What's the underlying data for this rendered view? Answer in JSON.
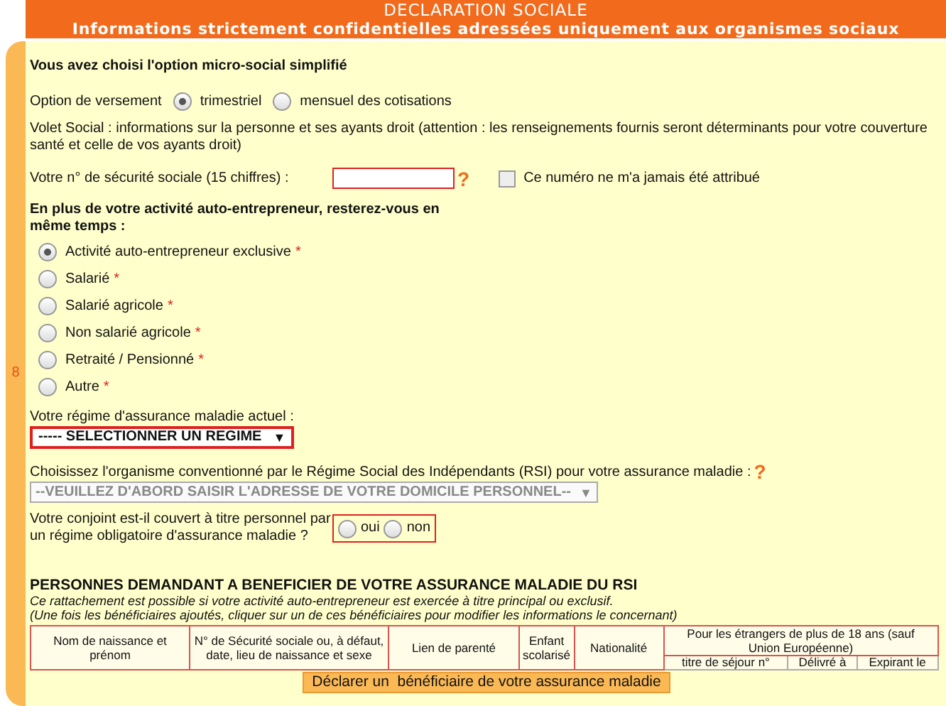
{
  "header": {
    "title": "DECLARATION SOCIALE",
    "subtitle": "Informations strictement confidentielles adressées uniquement aux organismes sociaux"
  },
  "side_number": "8",
  "intro": "Vous avez choisi l'option micro-social simplifié",
  "payment": {
    "label": "Option de versement",
    "options": [
      {
        "label": "trimestriel",
        "selected": true
      },
      {
        "label": "mensuel des cotisations",
        "selected": false
      }
    ]
  },
  "volet": "Volet Social : informations sur la personne et ses ayants droit (attention : les renseignements fournis seront déterminants pour votre couverture santé et celle de vos ayants droit)",
  "ssn": {
    "label": "Votre n° de sécurité sociale (15 chiffres) :",
    "help": "?",
    "checkbox": {
      "label": "Ce numéro ne m'a jamais été attribué",
      "checked": false
    }
  },
  "activity": {
    "question": "En plus de votre activité auto-entrepreneur, resterez-vous en même temps :",
    "options": [
      {
        "label": "Activité auto-entrepreneur exclusive",
        "required": "*",
        "selected": true
      },
      {
        "label": "Salarié",
        "required": "*",
        "selected": false
      },
      {
        "label": "Salarié agricole",
        "required": "*",
        "selected": false
      },
      {
        "label": "Non salarié agricole",
        "required": "*",
        "selected": false
      },
      {
        "label": "Retraité / Pensionné",
        "required": "*",
        "selected": false
      },
      {
        "label": "Autre",
        "required": "*",
        "selected": false
      }
    ]
  },
  "regime": {
    "label": "Votre régime d'assurance maladie actuel :",
    "value": "----- SELECTIONNER UN REGIME",
    "arrow": "▼"
  },
  "organisme": {
    "label": "Choisissez l'organisme conventionné par le Régime Social des Indépendants (RSI) pour votre assurance maladie :",
    "help": "?",
    "value": "--VEUILLEZ D'ABORD SAISIR L'ADRESSE DE VOTRE DOMICILE PERSONNEL--",
    "arrow": "▼",
    "disabled": true
  },
  "spouse": {
    "question": "Votre conjoint est-il couvert à titre personnel par un régime obligatoire d'assurance maladie ?",
    "options": [
      {
        "label": "oui",
        "selected": false
      },
      {
        "label": "non",
        "selected": false
      }
    ]
  },
  "beneficiaries": {
    "title": "PERSONNES DEMANDANT A BENEFICIER DE VOTRE ASSURANCE MALADIE DU RSI",
    "notes": [
      "Ce rattachement est possible si votre activité auto-entrepreneur est exercée à titre principal ou exclusif.",
      "(Une fois les bénéficiaires ajoutés, cliquer sur un de ces bénéficiaires pour modifier les informations le concernant)"
    ],
    "columns": [
      "Nom de naissance et prénom",
      "N° de Sécurité sociale ou, à défaut, date, lieu de naissance et sexe",
      "Lien de parenté",
      "Enfant scolarisé",
      "Nationalité"
    ],
    "group": {
      "label": "Pour les étrangers de plus de 18 ans (sauf Union Européenne)",
      "columns": [
        "titre de séjour n°",
        "Délivré à",
        "Expirant le"
      ]
    },
    "button": "Déclarer un  bénéficiaire de votre assurance maladie"
  }
}
